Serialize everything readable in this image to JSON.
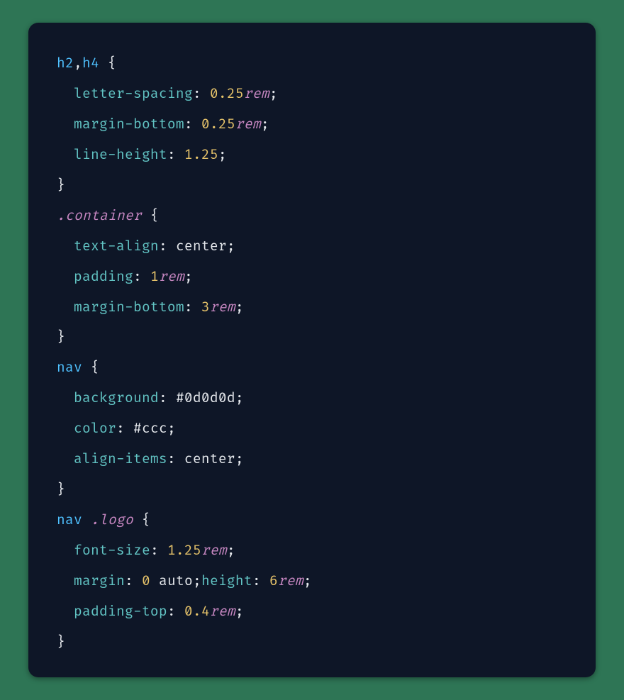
{
  "code": {
    "rules": [
      {
        "selector": [
          {
            "t": "tag",
            "v": "h2"
          },
          {
            "t": "punc",
            "v": ","
          },
          {
            "t": "tag",
            "v": "h4"
          }
        ],
        "decls": [
          [
            {
              "t": "prop",
              "v": "letter-spacing"
            },
            {
              "t": "punc",
              "v": ": "
            },
            {
              "t": "num",
              "v": "0.25"
            },
            {
              "t": "unit",
              "v": "rem"
            },
            {
              "t": "punc",
              "v": ";"
            }
          ],
          [
            {
              "t": "prop",
              "v": "margin-bottom"
            },
            {
              "t": "punc",
              "v": ": "
            },
            {
              "t": "num",
              "v": "0.25"
            },
            {
              "t": "unit",
              "v": "rem"
            },
            {
              "t": "punc",
              "v": ";"
            }
          ],
          [
            {
              "t": "prop",
              "v": "line-height"
            },
            {
              "t": "punc",
              "v": ": "
            },
            {
              "t": "num",
              "v": "1.25"
            },
            {
              "t": "punc",
              "v": ";"
            }
          ]
        ]
      },
      {
        "selector": [
          {
            "t": "class",
            "v": ".container"
          }
        ],
        "decls": [
          [
            {
              "t": "prop",
              "v": "text-align"
            },
            {
              "t": "punc",
              "v": ": "
            },
            {
              "t": "kw",
              "v": "center"
            },
            {
              "t": "punc",
              "v": ";"
            }
          ],
          [
            {
              "t": "prop",
              "v": "padding"
            },
            {
              "t": "punc",
              "v": ": "
            },
            {
              "t": "num",
              "v": "1"
            },
            {
              "t": "unit",
              "v": "rem"
            },
            {
              "t": "punc",
              "v": ";"
            }
          ],
          [
            {
              "t": "prop",
              "v": "margin-bottom"
            },
            {
              "t": "punc",
              "v": ": "
            },
            {
              "t": "num",
              "v": "3"
            },
            {
              "t": "unit",
              "v": "rem"
            },
            {
              "t": "punc",
              "v": ";"
            }
          ]
        ]
      },
      {
        "selector": [
          {
            "t": "tag",
            "v": "nav"
          }
        ],
        "decls": [
          [
            {
              "t": "prop",
              "v": "background"
            },
            {
              "t": "punc",
              "v": ": "
            },
            {
              "t": "hex",
              "v": "#0d0d0d"
            },
            {
              "t": "punc",
              "v": ";"
            }
          ],
          [
            {
              "t": "prop",
              "v": "color"
            },
            {
              "t": "punc",
              "v": ": "
            },
            {
              "t": "hex",
              "v": "#ccc"
            },
            {
              "t": "punc",
              "v": ";"
            }
          ],
          [
            {
              "t": "prop",
              "v": "align-items"
            },
            {
              "t": "punc",
              "v": ": "
            },
            {
              "t": "kw",
              "v": "center"
            },
            {
              "t": "punc",
              "v": ";"
            }
          ]
        ]
      },
      {
        "selector": [
          {
            "t": "tag",
            "v": "nav"
          },
          {
            "t": "punc",
            "v": " "
          },
          {
            "t": "class",
            "v": ".logo"
          }
        ],
        "decls": [
          [
            {
              "t": "prop",
              "v": "font-size"
            },
            {
              "t": "punc",
              "v": ": "
            },
            {
              "t": "num",
              "v": "1.25"
            },
            {
              "t": "unit",
              "v": "rem"
            },
            {
              "t": "punc",
              "v": ";"
            }
          ],
          [
            {
              "t": "prop",
              "v": "margin"
            },
            {
              "t": "punc",
              "v": ": "
            },
            {
              "t": "num",
              "v": "0"
            },
            {
              "t": "punc",
              "v": " "
            },
            {
              "t": "kw",
              "v": "auto"
            },
            {
              "t": "punc",
              "v": ";"
            },
            {
              "t": "prop",
              "v": "height"
            },
            {
              "t": "punc",
              "v": ": "
            },
            {
              "t": "num",
              "v": "6"
            },
            {
              "t": "unit",
              "v": "rem"
            },
            {
              "t": "punc",
              "v": ";"
            }
          ],
          [
            {
              "t": "prop",
              "v": "padding-top"
            },
            {
              "t": "punc",
              "v": ": "
            },
            {
              "t": "num",
              "v": "0.4"
            },
            {
              "t": "unit",
              "v": "rem"
            },
            {
              "t": "punc",
              "v": ";"
            }
          ]
        ]
      }
    ]
  }
}
